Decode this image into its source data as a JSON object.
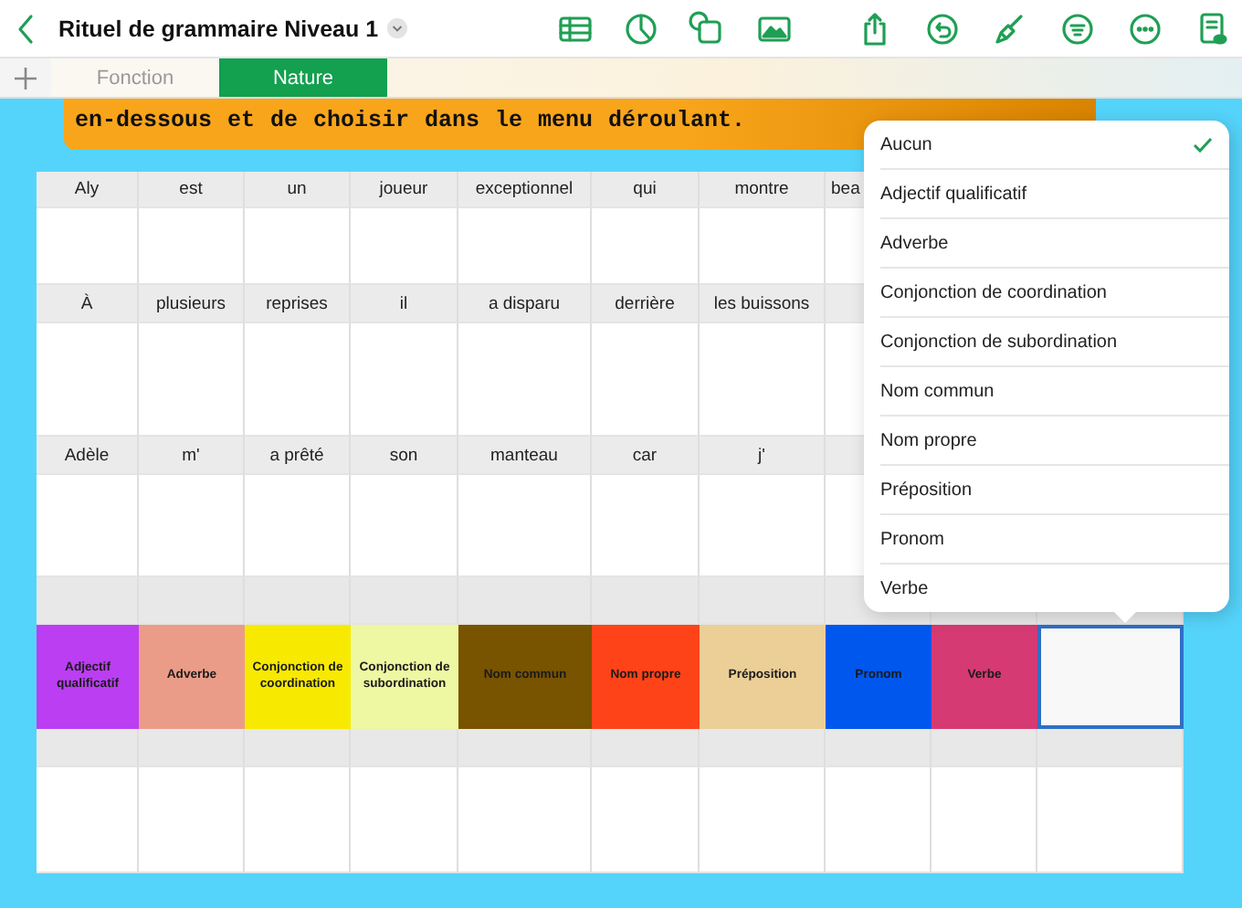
{
  "document": {
    "title": "Rituel de grammaire Niveau 1"
  },
  "sheet_tabs": [
    {
      "label": "Fonction",
      "selected": false
    },
    {
      "label": "Nature",
      "selected": true
    }
  ],
  "banner": {
    "text": "en-dessous et de choisir dans le menu déroulant."
  },
  "table": {
    "rows": [
      {
        "kind": "words",
        "cells": [
          "Aly",
          "est",
          "un",
          "joueur",
          "exceptionnel",
          "qui",
          "montre",
          "bea"
        ]
      },
      {
        "kind": "blank"
      },
      {
        "kind": "words",
        "cells": [
          "À",
          "plusieurs",
          "reprises",
          "il",
          "a disparu",
          "derrière",
          "les buissons"
        ]
      },
      {
        "kind": "blank"
      },
      {
        "kind": "words",
        "cells": [
          "Adèle",
          "m'",
          "a prêté",
          "son",
          "manteau",
          "car",
          "j'"
        ]
      },
      {
        "kind": "blank"
      },
      {
        "kind": "band"
      },
      {
        "kind": "legend",
        "cells": [
          {
            "label": "Adjectif qualificatif",
            "color": "#bb3ef2",
            "selected": false
          },
          {
            "label": "Adverbe",
            "color": "#eb9c88",
            "selected": false
          },
          {
            "label": "Conjonction de coordination",
            "color": "#f7ea00",
            "selected": false
          },
          {
            "label": "Conjonction de subordination",
            "color": "#eef7a2",
            "selected": false
          },
          {
            "label": "Nom commun",
            "color": "#785300",
            "selected": false
          },
          {
            "label": "Nom propre",
            "color": "#ff4318",
            "selected": false
          },
          {
            "label": "Préposition",
            "color": "#eccf97",
            "selected": false
          },
          {
            "label": "Pronom",
            "color": "#0057ee",
            "selected": false
          },
          {
            "label": "Verbe",
            "color": "#d53a72",
            "selected": false
          },
          {
            "color": "#f8f8f8",
            "selected": true
          }
        ]
      },
      {
        "kind": "band"
      },
      {
        "kind": "blank"
      }
    ]
  },
  "popup_menu": {
    "items": [
      {
        "label": "Aucun",
        "checked": true
      },
      {
        "label": "Adjectif qualificatif",
        "checked": false
      },
      {
        "label": "Adverbe",
        "checked": false
      },
      {
        "label": "Conjonction de coordination",
        "checked": false
      },
      {
        "label": "Conjonction de subordination",
        "checked": false
      },
      {
        "label": "Nom commun",
        "checked": false
      },
      {
        "label": "Nom propre",
        "checked": false
      },
      {
        "label": "Préposition",
        "checked": false
      },
      {
        "label": "Pronom",
        "checked": false
      },
      {
        "label": "Verbe",
        "checked": false
      }
    ]
  }
}
